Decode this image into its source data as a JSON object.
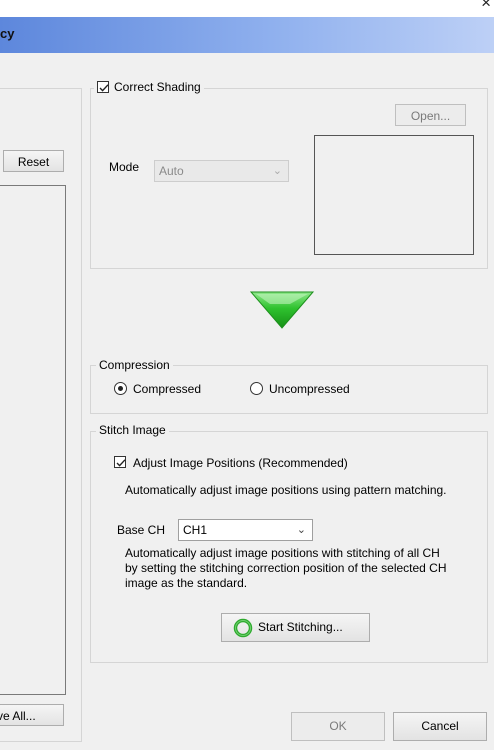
{
  "window": {
    "title": "cy",
    "close_glyph": "×"
  },
  "left_panel": {
    "reset_label": "Reset",
    "bottom_button_label": "ve All..."
  },
  "shading": {
    "checkbox_label": "Correct Shading",
    "checked": true,
    "open_label": "Open...",
    "mode_label": "Mode",
    "mode_value": "Auto"
  },
  "compression": {
    "legend": "Compression",
    "options": [
      {
        "label": "Compressed",
        "selected": true
      },
      {
        "label": "Uncompressed",
        "selected": false
      }
    ]
  },
  "stitch": {
    "legend": "Stitch Image",
    "adjust_label": "Adjust Image Positions (Recommended)",
    "adjust_checked": true,
    "adjust_desc": "Automatically adjust image positions using pattern matching.",
    "base_ch_label": "Base CH",
    "base_ch_value": "CH1",
    "base_desc_line1": "Automatically adjust image positions with stitching of all CH",
    "base_desc_line2": "by setting the stitching correction position of the selected CH",
    "base_desc_line3": "image as the standard.",
    "start_label": "Start Stitching..."
  },
  "footer": {
    "ok_label": "OK",
    "cancel_label": "Cancel"
  },
  "colors": {
    "arrow_green": "#2fb52f",
    "titlebar": "#7aa0e8",
    "stitch_icon": "#2eaa2e"
  },
  "icons": [
    "close-icon",
    "checkbox-check-icon",
    "chevron-down-icon",
    "down-arrow-icon",
    "stitch-ring-icon"
  ]
}
